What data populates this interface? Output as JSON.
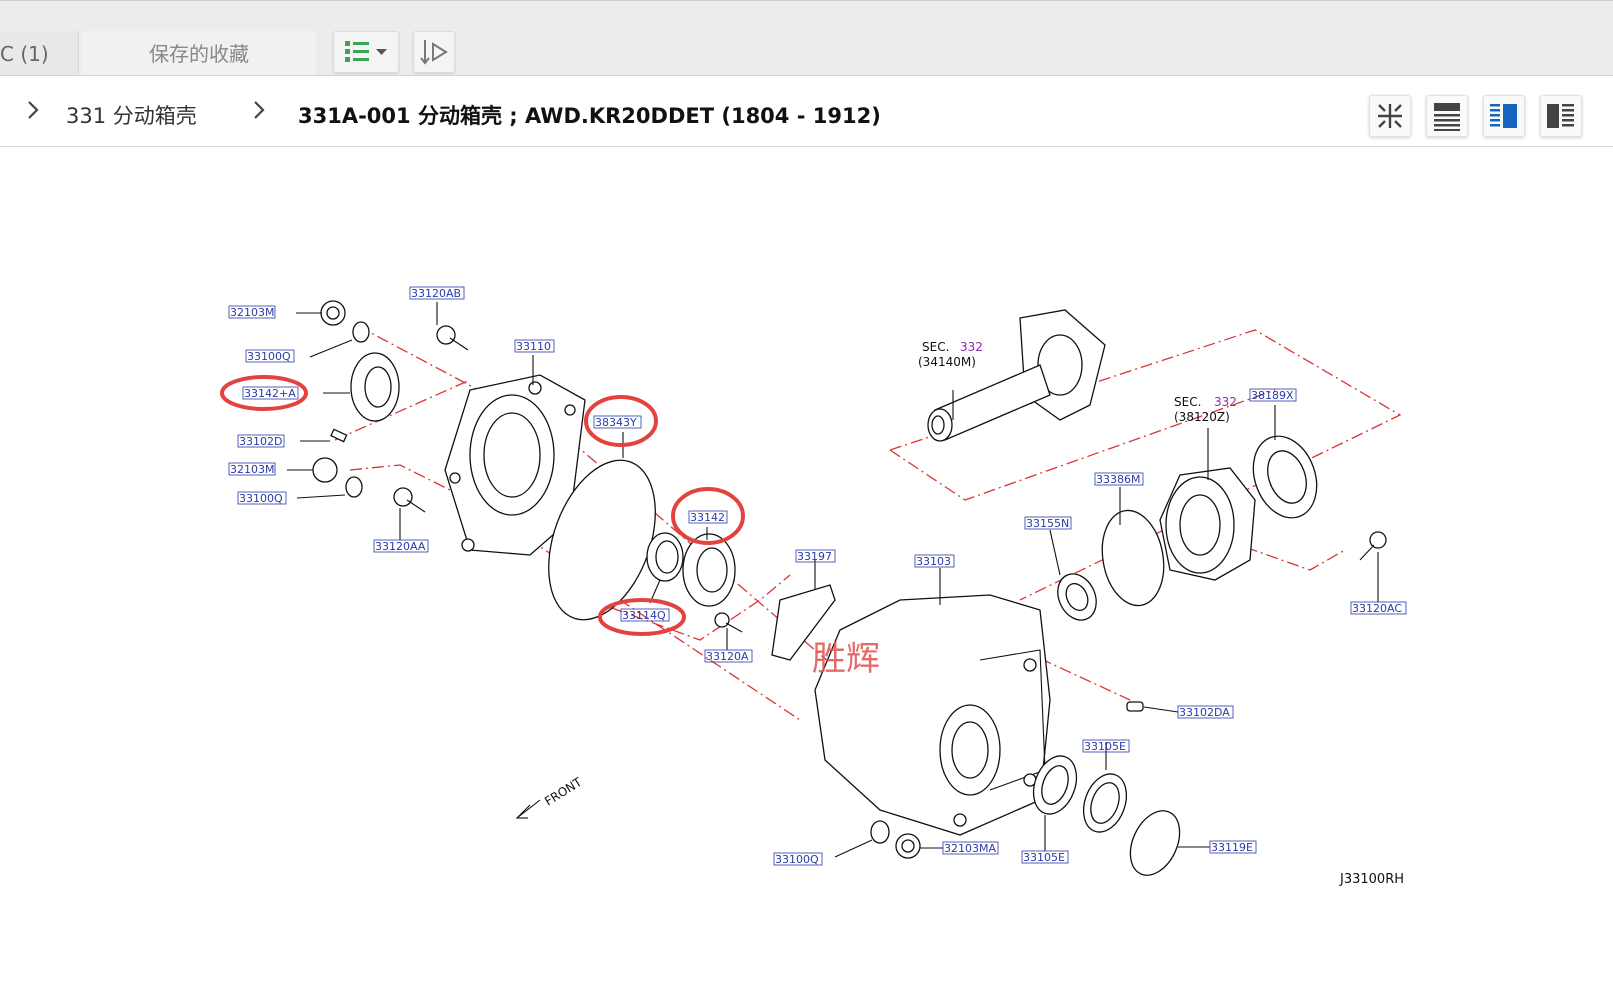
{
  "tabs": {
    "active_label": "C (1)",
    "favorites_label": "保存的收藏"
  },
  "breadcrumb": {
    "level1": "331 分动箱壳",
    "level2": "331A-001 分动箱壳 ; AWD.KR20DDET (1804 - 1912)"
  },
  "toolbar_icons": [
    "list-view-icon",
    "sort-icon"
  ],
  "view_icons": [
    "collapse-icon",
    "full-list-icon",
    "split-view-icon",
    "detail-view-icon"
  ],
  "diagram": {
    "parts": [
      "32103M",
      "33120AB",
      "33100Q",
      "33110",
      "33142+A",
      "38343Y",
      "33102D",
      "32103M",
      "33100Q",
      "33120AA",
      "33142",
      "33114Q",
      "33120A",
      "33197",
      "33103",
      "33155N",
      "33386M",
      "38189X",
      "33120AC",
      "33102DA",
      "33105E",
      "33105E",
      "33119E",
      "32103MA",
      "33100Q"
    ],
    "sec1_label": "SEC.",
    "sec1_num": "332",
    "sec1_code": "(34140M)",
    "sec2_label": "SEC.",
    "sec2_num": "332",
    "sec2_code": "(38120Z)",
    "front_label": "FRONT",
    "figure_id": "J33100RH",
    "watermark": "胜辉",
    "highlighted_parts": [
      "33142+A",
      "38343Y",
      "33142",
      "33114Q"
    ]
  },
  "colors": {
    "part_number": "#2b3aa8",
    "highlight": "#e3433f",
    "dash_line": "#dd3333",
    "list_icon_green": "#3aa655",
    "view_icon_blue": "#1565c0"
  }
}
